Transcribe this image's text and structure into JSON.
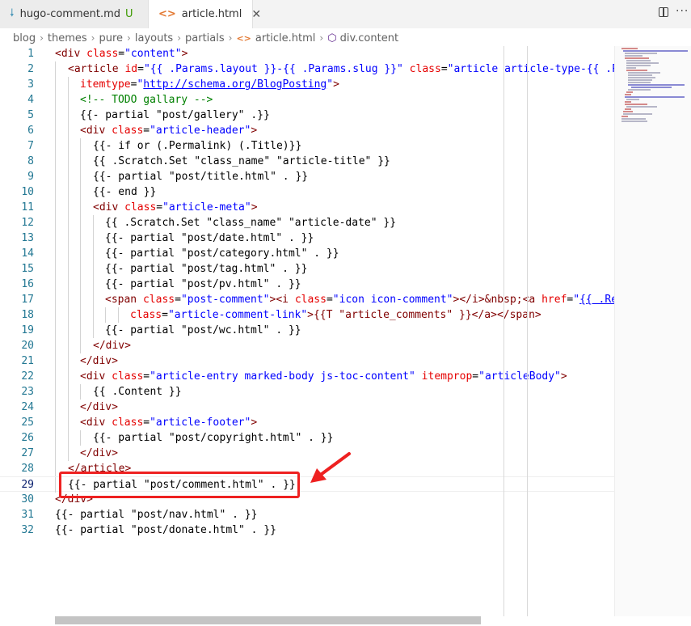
{
  "tabs": [
    {
      "label": "hugo-comment.md",
      "status": "U",
      "icon": "markdown-download-icon",
      "close": "✕"
    },
    {
      "label": "article.html",
      "icon": "html-brackets-icon",
      "close": "✕"
    }
  ],
  "breadcrumb": [
    "blog",
    "themes",
    "pure",
    "layouts",
    "partials",
    "article.html",
    "div.content"
  ],
  "colors": {
    "tag": "#800000",
    "attr": "#e50000",
    "value": "#0000ff",
    "comment": "#008000",
    "line_number": "#237893",
    "highlight": "#ee2121"
  },
  "lines": [
    {
      "n": "1"
    },
    {
      "n": "2"
    },
    {
      "n": "3"
    },
    {
      "n": "4"
    },
    {
      "n": "5"
    },
    {
      "n": "6"
    },
    {
      "n": "7"
    },
    {
      "n": "8"
    },
    {
      "n": "9"
    },
    {
      "n": "10"
    },
    {
      "n": "11"
    },
    {
      "n": "12"
    },
    {
      "n": "13"
    },
    {
      "n": "14"
    },
    {
      "n": "15"
    },
    {
      "n": "16"
    },
    {
      "n": "17"
    },
    {
      "n": "18"
    },
    {
      "n": "19"
    },
    {
      "n": "20"
    },
    {
      "n": "21"
    },
    {
      "n": "22"
    },
    {
      "n": "23"
    },
    {
      "n": "24"
    },
    {
      "n": "25"
    },
    {
      "n": "26"
    },
    {
      "n": "27"
    },
    {
      "n": "28"
    },
    {
      "n": "29"
    },
    {
      "n": "30"
    },
    {
      "n": "31"
    },
    {
      "n": "32"
    }
  ],
  "code": {
    "l1": [
      "<div",
      " class",
      "=",
      "\"content\"",
      ">"
    ],
    "l2": [
      "<article",
      " id",
      "=",
      "\"{{ .Params.layout }}-{{ .Params.slug }}\"",
      " class",
      "=",
      "\"article article-type-{{ .Pa"
    ],
    "l3": [
      "itemtype",
      "=",
      "\"",
      "http://schema.org/BlogPosting",
      "\"",
      ">"
    ],
    "l4": "<!-- TODO gallary -->",
    "l5": "{{- partial \"post/gallery\" .}}",
    "l6": [
      "<div",
      " class",
      "=",
      "\"article-header\"",
      ">"
    ],
    "l7": "{{- if or (.Permalink) (.Title)}}",
    "l8": "{{ .Scratch.Set \"class_name\" \"article-title\" }}",
    "l9": "{{- partial \"post/title.html\" . }}",
    "l10": "{{- end }}",
    "l11": [
      "<div",
      " class",
      "=",
      "\"article-meta\"",
      ">"
    ],
    "l12": "{{ .Scratch.Set \"class_name\" \"article-date\" }}",
    "l13": "{{- partial \"post/date.html\" . }}",
    "l14": "{{- partial \"post/category.html\" . }}",
    "l15": "{{- partial \"post/tag.html\" . }}",
    "l16": "{{- partial \"post/pv.html\" . }}",
    "l17": [
      "<span",
      " class",
      "=",
      "\"post-comment\"",
      "><i",
      " class",
      "=",
      "\"icon icon-comment\"",
      "></i>&nbsp;<a",
      " href",
      "=",
      "\"",
      "{{ .Rel"
    ],
    "l18": [
      "class",
      "=",
      "\"article-comment-link\"",
      ">{{T \"article_comments\" }}</a></span>"
    ],
    "l19": "{{- partial \"post/wc.html\" . }}",
    "l20": "</div>",
    "l21": "</div>",
    "l22": [
      "<div",
      " class",
      "=",
      "\"article-entry marked-body js-toc-content\"",
      " itemprop",
      "=",
      "\"articleBody\"",
      ">"
    ],
    "l23": "{{ .Content }}",
    "l24": "</div>",
    "l25": [
      "<div",
      " class",
      "=",
      "\"article-footer\"",
      ">"
    ],
    "l26": "{{- partial \"post/copyright.html\" . }}",
    "l27": "</div>",
    "l28": "</article>",
    "l29": "{{- partial \"post/comment.html\" . }}",
    "l30": "</div>",
    "l31": "{{- partial \"post/nav.html\" . }}",
    "l32": "{{- partial \"post/donate.html\" . }}"
  }
}
